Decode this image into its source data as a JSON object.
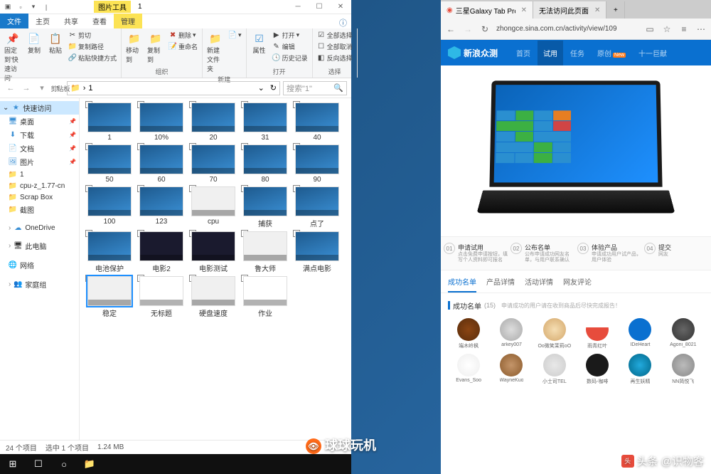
{
  "explorer": {
    "contextTab": "图片工具",
    "titleText": "1",
    "tabs": {
      "file": "文件",
      "home": "主页",
      "share": "共享",
      "view": "查看",
      "manage": "管理"
    },
    "ribbon": {
      "pin": "固定到'快速访问'",
      "copy": "复制",
      "paste": "粘贴",
      "cut": "剪切",
      "copyPath": "复制路径",
      "pasteShortcut": "粘贴快捷方式",
      "clipboard": "剪贴板",
      "moveTo": "移动到",
      "copyTo": "复制到",
      "delete": "删除",
      "rename": "重命名",
      "organize": "组织",
      "newFolder": "新建文件夹",
      "new": "新建",
      "properties": "属性",
      "open": "打开",
      "edit": "编辑",
      "history": "历史记录",
      "openGroup": "打开",
      "selectAll": "全部选择",
      "selectNone": "全部取消",
      "invertSel": "反向选择",
      "select": "选择"
    },
    "breadcrumb": "1",
    "searchPlaceholder": "搜索\"1\"",
    "sidebar": {
      "quickAccess": "快速访问",
      "desktop": "桌面",
      "downloads": "下载",
      "documents": "文档",
      "pictures": "图片",
      "folder1": "1",
      "cpuz": "cpu-z_1.77-cn",
      "scrapbox": "Scrap Box",
      "screenshots": "截图",
      "onedrive": "OneDrive",
      "thispc": "此电脑",
      "network": "网络",
      "homegroup": "家庭组"
    },
    "files": [
      {
        "name": "1"
      },
      {
        "name": "10%"
      },
      {
        "name": "20"
      },
      {
        "name": "31"
      },
      {
        "name": "40"
      },
      {
        "name": "50"
      },
      {
        "name": "60"
      },
      {
        "name": "70"
      },
      {
        "name": "80"
      },
      {
        "name": "90"
      },
      {
        "name": "100"
      },
      {
        "name": "123"
      },
      {
        "name": "cpu",
        "thumb": "win"
      },
      {
        "name": "捕获"
      },
      {
        "name": "点了",
        "checked": true
      },
      {
        "name": "电池保护"
      },
      {
        "name": "电影2",
        "thumb": "dark"
      },
      {
        "name": "电影测试",
        "thumb": "dark"
      },
      {
        "name": "鲁大师",
        "thumb": "win"
      },
      {
        "name": "满点电影"
      },
      {
        "name": "稳定",
        "thumb": "win",
        "selected": true
      },
      {
        "name": "无标题",
        "thumb": "white"
      },
      {
        "name": "硬盘速度",
        "thumb": "win"
      },
      {
        "name": "作业",
        "thumb": "white"
      }
    ],
    "status": {
      "items": "24 个项目",
      "selected": "选中 1 个项目",
      "size": "1.24 MB"
    }
  },
  "browser": {
    "tab1": "三星Galaxy Tab Pro S -",
    "tab2": "无法访问此页面",
    "url": "zhongce.sina.com.cn/activity/view/109",
    "site": {
      "name": "新浪众测",
      "nav": [
        "首页",
        "试用",
        "任务",
        "原创",
        "十一巨献"
      ]
    },
    "steps": [
      {
        "num": "01",
        "title": "申请试用",
        "desc": "点击免费申请按钮，填写个人资料即可报名"
      },
      {
        "num": "02",
        "title": "公布名单",
        "desc": "公布申请成功网友名单，与用户联系确认"
      },
      {
        "num": "03",
        "title": "体验产品",
        "desc": "申请成功用户试产品，用户体验"
      },
      {
        "num": "04",
        "title": "提交",
        "desc": "网友"
      }
    ],
    "contentTabs": [
      "成功名单",
      "产品详情",
      "活动详情",
      "网友评论"
    ],
    "sectionTitle": "成功名单",
    "sectionCount": "(15)",
    "sectionNote": "申请成功的用户请在收到商品后尽快完成报告！",
    "users": [
      "端木岭枫",
      "arkey007",
      "Oo微笑茉莉oO",
      "雨青红叶",
      "IDeHeart",
      "Agoni_8021",
      "Evans_Soo",
      "WayneKuo",
      "小士司TEL",
      "数码-咖啡",
      "再生妖精",
      "NN简悦飞"
    ]
  },
  "watermark1": "球球玩机",
  "watermark2": "头条 @识物客",
  "sinaWm": "新浪众测"
}
